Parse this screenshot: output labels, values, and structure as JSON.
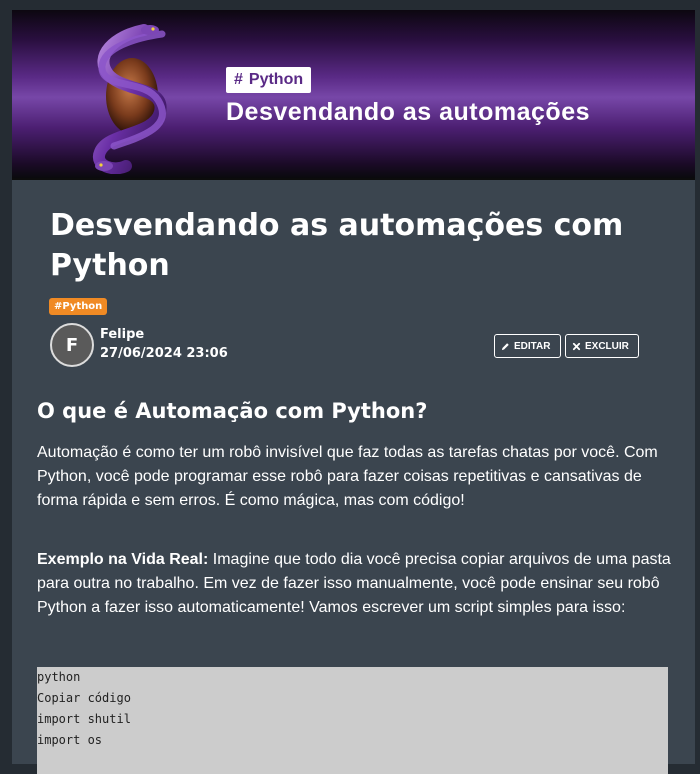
{
  "banner": {
    "tag": "Python",
    "tag_hash": "#",
    "title": "Desvendando as automações"
  },
  "post": {
    "title": "Desvendando as automações com Python",
    "tag": "#Python",
    "author_initial": "F",
    "author": "Felipe",
    "date": "27/06/2024 23:06",
    "edit_label": "EDITAR",
    "delete_label": "EXCLUIR"
  },
  "content": {
    "heading": "O que é Automação com Python?",
    "paragraph_1": "Automação é como ter um robô invisível que faz todas as tarefas chatas por você. Com Python, você pode programar esse robô para fazer coisas repetitivas e cansativas de forma rápida e sem erros. É como mágica, mas com código!",
    "paragraph_2_bold": "Exemplo na Vida Real:",
    "paragraph_2": " Imagine que todo dia você precisa copiar arquivos de uma pasta para outra no trabalho. Em vez de fazer isso manualmente, você pode ensinar seu robô Python a fazer isso automaticamente! Vamos escrever um script simples para isso:",
    "code_lines": [
      "python",
      "Copiar código",
      "import shutil",
      "import os"
    ]
  },
  "colors": {
    "background": "#252c33",
    "card": "#3b454f",
    "accent_tag": "#f08a24",
    "banner_purple": "#5a2a86",
    "code_bg": "#cccccc"
  },
  "icons": [
    "snake-egg-illustration",
    "pencil-icon",
    "close-icon"
  ]
}
